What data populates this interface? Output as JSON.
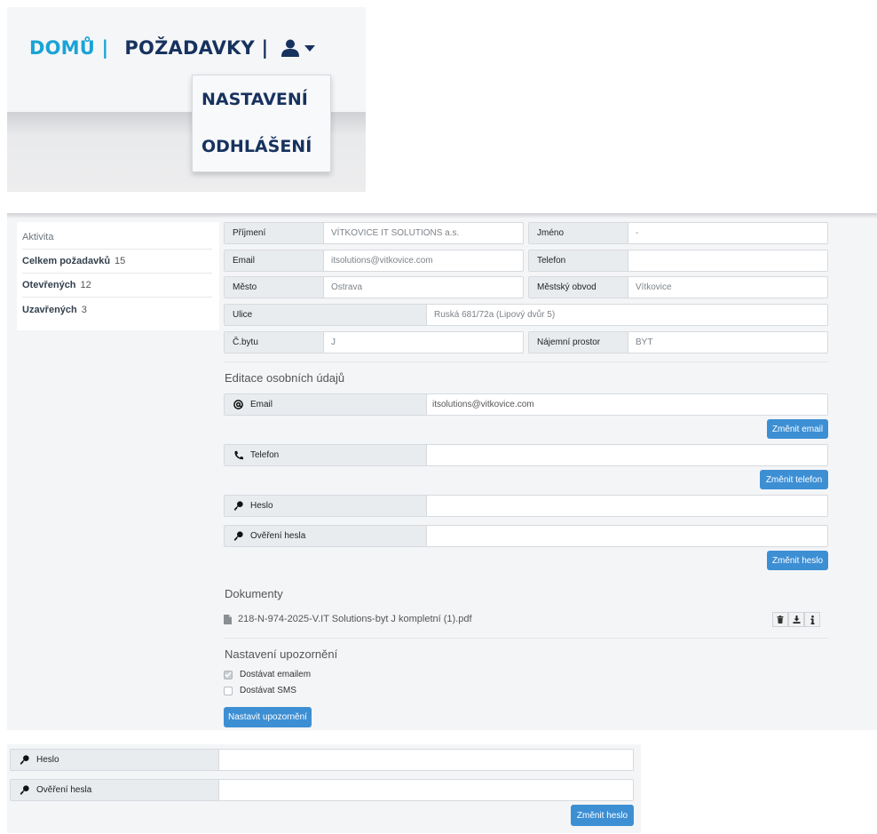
{
  "nav": {
    "home": "DOMŮ |",
    "requests": "POŽADAVKY |",
    "user_icon": "user-icon",
    "dropdown": [
      "NASTAVENÍ",
      "ODHLÁŠENÍ"
    ]
  },
  "sidebar": {
    "header": "Aktivita",
    "items": [
      {
        "label": "Celkem požadavků",
        "count": "15"
      },
      {
        "label": "Otevřených",
        "count": "12"
      },
      {
        "label": "Uzavřených",
        "count": "3"
      }
    ]
  },
  "profile": {
    "prijmeni_label": "Příjmení",
    "prijmeni_value": "VÍTKOVICE IT SOLUTIONS a.s.",
    "jmeno_label": "Jméno",
    "jmeno_value": "-",
    "email_label": "Email",
    "email_value": "itsolutions@vitkovice.com",
    "telefon_label": "Telefon",
    "telefon_value": "",
    "mesto_label": "Město",
    "mesto_value": "Ostrava",
    "obvod_label": "Městský obvod",
    "obvod_value": "Vítkovice",
    "ulice_label": "Ulice",
    "ulice_value": "Ruská 681/72a (Lipový dvůr 5)",
    "cbytu_label": "Č.bytu",
    "cbytu_value": "J",
    "prostor_label": "Nájemní prostor",
    "prostor_value": "BYT"
  },
  "edit": {
    "title": "Editace osobních údajů",
    "email_label": "Email",
    "email_value": "itsolutions@vitkovice.com",
    "email_button": "Změnit email",
    "telefon_label": "Telefon",
    "telefon_value": "",
    "telefon_button": "Změnit telefon",
    "heslo_label": "Heslo",
    "overeni_label": "Ověření hesla",
    "heslo_button": "Změnit heslo"
  },
  "documents": {
    "title": "Dokumenty",
    "file_name": "218-N-974-2025-V.IT Solutions-byt J kompletní (1).pdf"
  },
  "notifications": {
    "title": "Nastavení upozornění",
    "email_option": "Dostávat emailem",
    "email_checked": true,
    "sms_option": "Dostávat SMS",
    "sms_checked": false,
    "button": "Nastavit upozornění"
  },
  "password_panel": {
    "heslo_label": "Heslo",
    "overeni_label": "Ověření hesla",
    "button": "Změnit heslo"
  },
  "colors": {
    "brand_cyan": "#1aa3d6",
    "brand_navy": "#17325e",
    "primary_button": "#3d8fd4"
  }
}
